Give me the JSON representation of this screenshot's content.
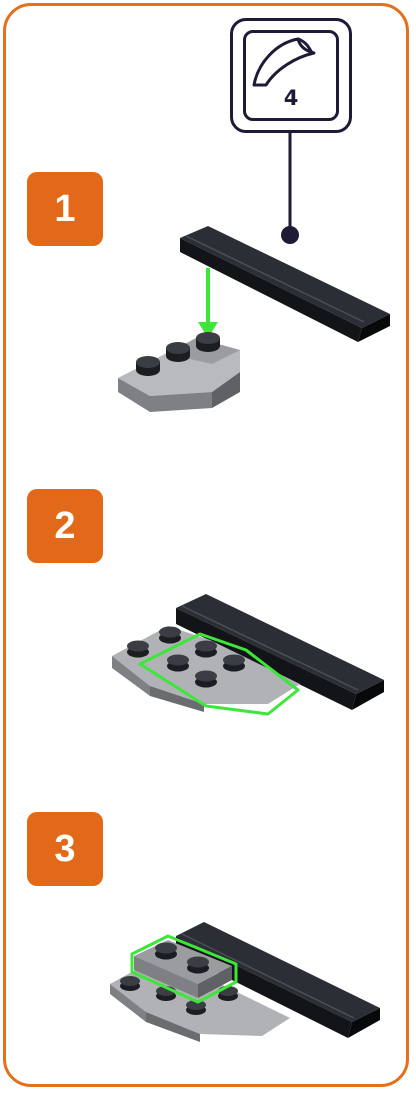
{
  "steps": [
    {
      "number": "1"
    },
    {
      "number": "2"
    },
    {
      "number": "3"
    }
  ],
  "callout": {
    "quantity": "4",
    "icon": "curved-slope-piece-icon"
  },
  "colors": {
    "accent": "#e3701c",
    "badge": "#e3691a",
    "brick_dark": "#111318",
    "brick_grey": "#a7a9ac",
    "highlight": "#3ee53b",
    "callout_line": "#1f1a35"
  }
}
